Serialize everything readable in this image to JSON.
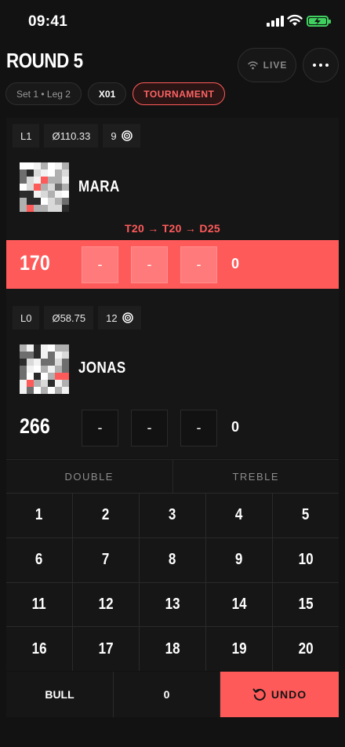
{
  "status": {
    "time": "09:41"
  },
  "header": {
    "title": "ROUND 5",
    "live_label": "LIVE",
    "chips": {
      "set_leg": "Set 1 • Leg 2",
      "mode": "X01",
      "event": "TOURNAMENT"
    }
  },
  "players": [
    {
      "leg": "L1",
      "average": "Ø110.33",
      "darts": "9",
      "name": "MARA",
      "checkout": "T20 → T20 → D25",
      "score": "170",
      "throws": [
        "-",
        "-",
        "-"
      ],
      "round_total": "0",
      "active": true
    },
    {
      "leg": "L0",
      "average": "Ø58.75",
      "darts": "12",
      "name": "JONAS",
      "checkout": "",
      "score": "266",
      "throws": [
        "-",
        "-",
        "-"
      ],
      "round_total": "0",
      "active": false
    }
  ],
  "keypad": {
    "modes": [
      "DOUBLE",
      "TREBLE"
    ],
    "numbers": [
      "1",
      "2",
      "3",
      "4",
      "5",
      "6",
      "7",
      "8",
      "9",
      "10",
      "11",
      "12",
      "13",
      "14",
      "15",
      "16",
      "17",
      "18",
      "19",
      "20"
    ],
    "bull_label": "BULL",
    "zero_label": "0",
    "undo_label": "UNDO"
  },
  "colors": {
    "accent": "#ff5a5a",
    "background": "#121212",
    "panel": "#161616",
    "battery": "#3fcf5f"
  }
}
